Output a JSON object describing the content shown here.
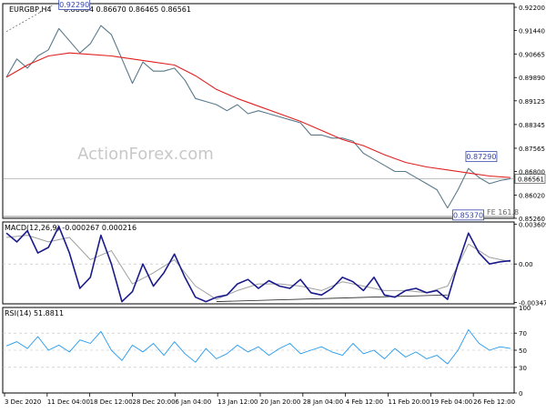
{
  "header": {
    "symbol": "EURGBP,H4",
    "ohlc": "0.86604 0.86670 0.86465 0.86561"
  },
  "watermark": "ActionForex.com",
  "colors": {
    "price": "#5a7a8c",
    "ma": "#e02020",
    "macd": "#1a1a8c",
    "signal": "#a0a0a0",
    "rsi": "#2299ee",
    "level_box": "#3344aa",
    "fib": "#666666"
  },
  "chart_data": [
    {
      "type": "line",
      "panel": "price",
      "y_ticks": [
        "0.92200",
        "0.91440",
        "0.90665",
        "0.89890",
        "0.89125",
        "0.88345",
        "0.87565",
        "0.86800",
        "0.86020",
        "0.85260"
      ],
      "ylim": [
        0.8526,
        0.9232
      ],
      "current_price": "0.86561",
      "labels": [
        {
          "text": "0.92290",
          "x": 10,
          "y": 0.9229
        },
        {
          "text": "0.87290",
          "x": 87.5,
          "y": 0.8729
        },
        {
          "text": "0.85370",
          "x": 85,
          "y": 0.8537
        }
      ],
      "fib_label": "FE 161.8",
      "series": [
        {
          "name": "price",
          "x": [
            0,
            2,
            4,
            6,
            8,
            10,
            12,
            14,
            16,
            18,
            20,
            22,
            24,
            26,
            28,
            30,
            32,
            34,
            36,
            38,
            40,
            42,
            44,
            46,
            48,
            50,
            52,
            54,
            56,
            58,
            60,
            62,
            64,
            66,
            68,
            70,
            72,
            74,
            76,
            78,
            80,
            82,
            84,
            86,
            88,
            90,
            92,
            94,
            96
          ],
          "values": [
            0.899,
            0.905,
            0.902,
            0.906,
            0.908,
            0.915,
            0.911,
            0.907,
            0.91,
            0.916,
            0.913,
            0.905,
            0.897,
            0.904,
            0.901,
            0.901,
            0.902,
            0.898,
            0.892,
            0.891,
            0.89,
            0.888,
            0.89,
            0.887,
            0.888,
            0.887,
            0.886,
            0.885,
            0.884,
            0.88,
            0.88,
            0.879,
            0.879,
            0.878,
            0.874,
            0.872,
            0.87,
            0.868,
            0.868,
            0.866,
            0.864,
            0.862,
            0.856,
            0.862,
            0.869,
            0.866,
            0.864,
            0.865,
            0.8656
          ]
        },
        {
          "name": "MA",
          "x": [
            0,
            4,
            8,
            12,
            16,
            20,
            24,
            28,
            32,
            36,
            40,
            44,
            48,
            52,
            56,
            60,
            64,
            68,
            72,
            76,
            80,
            84,
            88,
            92,
            96
          ],
          "values": [
            0.899,
            0.903,
            0.906,
            0.907,
            0.9065,
            0.906,
            0.905,
            0.904,
            0.903,
            0.8995,
            0.895,
            0.892,
            0.8895,
            0.887,
            0.8845,
            0.8815,
            0.8785,
            0.8765,
            0.8735,
            0.871,
            0.8695,
            0.8685,
            0.8675,
            0.8665,
            0.866
          ]
        }
      ]
    },
    {
      "type": "line",
      "panel": "macd",
      "title": "MACD(12,26,9) -0.000267 0.000216",
      "y_ticks": [
        "0.003609",
        "0.00",
        "-0.003472"
      ],
      "ylim": [
        -0.0036,
        0.0038
      ],
      "series": [
        {
          "name": "MACD",
          "x": [
            0,
            2,
            4,
            6,
            8,
            10,
            12,
            14,
            16,
            18,
            20,
            22,
            24,
            26,
            28,
            30,
            32,
            34,
            36,
            38,
            40,
            42,
            44,
            46,
            48,
            50,
            52,
            54,
            56,
            58,
            60,
            62,
            64,
            66,
            68,
            70,
            72,
            74,
            76,
            78,
            80,
            82,
            84,
            86,
            88,
            90,
            92,
            94,
            96
          ],
          "values": [
            0.0028,
            0.002,
            0.003,
            0.001,
            0.0015,
            0.0034,
            0.001,
            -0.0022,
            -0.0012,
            0.0026,
            0.0,
            -0.0034,
            -0.0025,
            0.0,
            -0.002,
            -0.0008,
            0.0009,
            -0.0012,
            -0.003,
            -0.0034,
            -0.003,
            -0.0028,
            -0.0018,
            -0.0014,
            -0.0022,
            -0.0015,
            -0.002,
            -0.0022,
            -0.0014,
            -0.0026,
            -0.0028,
            -0.0022,
            -0.0012,
            -0.0016,
            -0.0024,
            -0.0012,
            -0.0028,
            -0.003,
            -0.0024,
            -0.0022,
            -0.0026,
            -0.0024,
            -0.0032,
            0.0,
            0.0028,
            0.001,
            0.0,
            0.0002,
            0.0003
          ]
        },
        {
          "name": "Signal",
          "x": [
            0,
            4,
            8,
            12,
            16,
            20,
            24,
            28,
            32,
            36,
            40,
            44,
            48,
            52,
            56,
            60,
            64,
            68,
            72,
            76,
            80,
            84,
            88,
            92,
            96
          ],
          "values": [
            0.0024,
            0.0026,
            0.002,
            0.0024,
            0.0004,
            0.0012,
            -0.0018,
            -0.0008,
            0.0004,
            -0.002,
            -0.0032,
            -0.0024,
            -0.0018,
            -0.0018,
            -0.002,
            -0.0024,
            -0.0016,
            -0.002,
            -0.0024,
            -0.0024,
            -0.0026,
            -0.002,
            0.0018,
            0.0006,
            0.0002
          ]
        }
      ]
    },
    {
      "type": "line",
      "panel": "rsi",
      "title": "RSI(14) 51.8811",
      "y_ticks": [
        "100",
        "70",
        "50",
        "30",
        "0"
      ],
      "ylim": [
        0,
        100
      ],
      "series": [
        {
          "name": "RSI",
          "x": [
            0,
            2,
            4,
            6,
            8,
            10,
            12,
            14,
            16,
            18,
            20,
            22,
            24,
            26,
            28,
            30,
            32,
            34,
            36,
            38,
            40,
            42,
            44,
            46,
            48,
            50,
            52,
            54,
            56,
            58,
            60,
            62,
            64,
            66,
            68,
            70,
            72,
            74,
            76,
            78,
            80,
            82,
            84,
            86,
            88,
            90,
            92,
            94,
            96
          ],
          "values": [
            55,
            60,
            52,
            66,
            50,
            56,
            48,
            62,
            58,
            72,
            50,
            38,
            56,
            48,
            58,
            44,
            60,
            46,
            36,
            52,
            40,
            46,
            56,
            48,
            54,
            44,
            52,
            58,
            46,
            50,
            54,
            48,
            44,
            58,
            46,
            50,
            40,
            52,
            42,
            48,
            40,
            44,
            34,
            50,
            74,
            58,
            50,
            54,
            52
          ]
        }
      ]
    }
  ],
  "x_axis": [
    "3 Dec 2020",
    "11 Dec 04:00",
    "18 Dec 12:00",
    "28 Dec 20:00",
    "6 Jan 04:00",
    "13 Jan 12:00",
    "20 Jan 20:00",
    "28 Jan 04:00",
    "4 Feb 12:00",
    "11 Feb 20:00",
    "19 Feb 04:00",
    "26 Feb 12:00"
  ]
}
